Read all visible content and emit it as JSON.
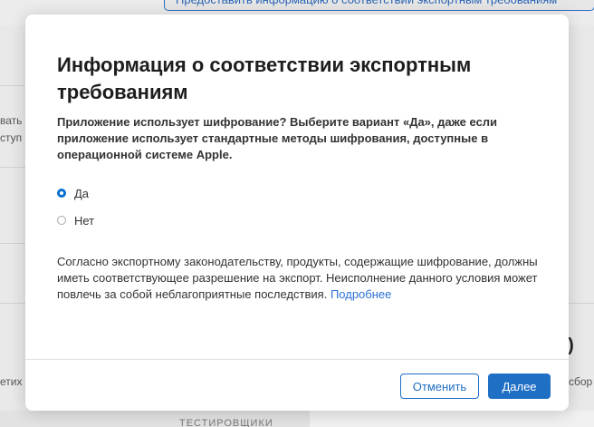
{
  "background": {
    "top_button_label": "Предоставить информацию о соответствии экспортным требованиям",
    "left_fragments": [
      "вать",
      "ступ",
      "етих"
    ],
    "right_fragments": [
      "сбор"
    ],
    "big_number": "0)",
    "footer_label": "ТЕСТИРОВЩИКИ"
  },
  "dialog": {
    "title": "Информация о соответствии экспортным требованиям",
    "question": "Приложение использует шифрование? Выберите вариант «Да», даже если приложение использует стандартные методы шифрования, доступные в операционной системе Apple.",
    "options": [
      {
        "label": "Да",
        "checked": true
      },
      {
        "label": "Нет",
        "checked": false
      }
    ],
    "note": "Согласно экспортному законодательству, продукты, содержащие шифрование, должны иметь соответствующее разрешение на экспорт. Неисполнение данного условия может повлечь за собой неблагоприятные последствия.",
    "learn_more_link": "Подробнее",
    "cancel_button": "Отменить",
    "next_button": "Далее"
  },
  "colors": {
    "accent": "#1f6fc5",
    "link": "#2a6fd6",
    "overlay": "#ececec"
  }
}
